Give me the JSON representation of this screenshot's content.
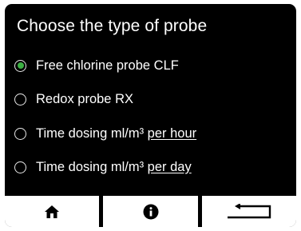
{
  "title": "Choose the type of probe",
  "options": [
    {
      "label": "Free chlorine probe CLF",
      "selected": true
    },
    {
      "label": "Redox probe RX",
      "selected": false
    },
    {
      "label_main": "Time dosing ml/m³ ",
      "label_underlined": "per hour",
      "selected": false
    },
    {
      "label_main": "Time dosing ml/m³ ",
      "label_underlined": "per day",
      "selected": false
    }
  ],
  "footer": {
    "buttons": [
      {
        "icon": "home-icon"
      },
      {
        "icon": "info-icon"
      },
      {
        "icon": "back-arrow-icon"
      }
    ]
  },
  "colors": {
    "background": "#000000",
    "text": "#ffffff",
    "selected_radio": "#3cb043",
    "footer_button": "#ffffff"
  }
}
